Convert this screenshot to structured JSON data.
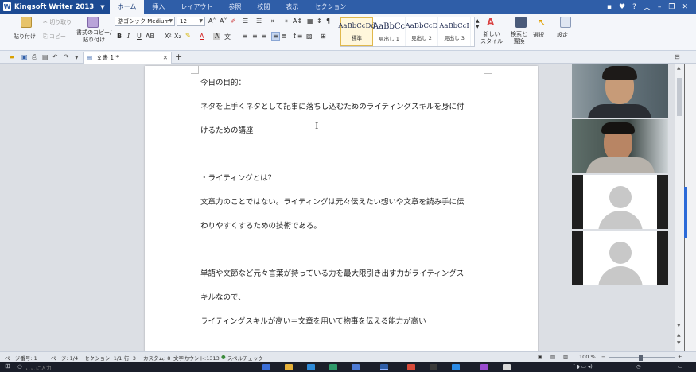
{
  "app": {
    "title": "Kingsoft Writer 2013"
  },
  "menu": {
    "tabs": [
      "ホーム",
      "挿入",
      "レイアウト",
      "参照",
      "校閲",
      "表示",
      "セクション"
    ]
  },
  "ribbon": {
    "paste_label": "貼り付け",
    "cut_label": "切り取り",
    "copy_label": "コピー",
    "format_painter_label": "書式のコピー/\n貼り付け",
    "font_name": "游ゴシック Medium",
    "font_size": "12",
    "styles": [
      {
        "sample": "AaBbCcDd",
        "name": "標準"
      },
      {
        "sample": "AaBbCc",
        "name": "見出し 1"
      },
      {
        "sample": "AaBbCcD",
        "name": "見出し 2"
      },
      {
        "sample": "AaBbCcI",
        "name": "見出し 3"
      }
    ],
    "new_style_label": "新しい\nスタイル",
    "find_replace_label": "検索と\n置換",
    "select_label": "選択",
    "settings_label": "設定"
  },
  "document_tab": {
    "name": "文書 1 *"
  },
  "document": {
    "lines": [
      "今日の目的：",
      "ネタを上手くネタとして記事に落ちし込むためのライティングスキルを身に付",
      "けるための講座",
      "",
      "・ライティングとは？",
      "文章力のことではない。ライティングは元々伝えたい想いや文章を読み手に伝",
      "わりやすくするための技術である。",
      "",
      "単語や文節など元々言葉が持っている力を最大限引き出す力がライティングス",
      "キルなので、",
      "ライティングスキルが高い＝文章を用いて物事を伝える能力が高い"
    ]
  },
  "status": {
    "page_number": "ページ番号: 1",
    "page": "ページ: 1/4",
    "section": "セクション: 1/1",
    "row": "行: 3",
    "column": "カスタム: 8",
    "word_count": "文字カウント:1313",
    "spellcheck": "スペルチェック",
    "zoom": "100 %"
  },
  "taskbar": {
    "search_placeholder": "ここに入力"
  },
  "colors": {
    "title_bar": "#2f5ea8",
    "accent": "#2b6ad8"
  }
}
